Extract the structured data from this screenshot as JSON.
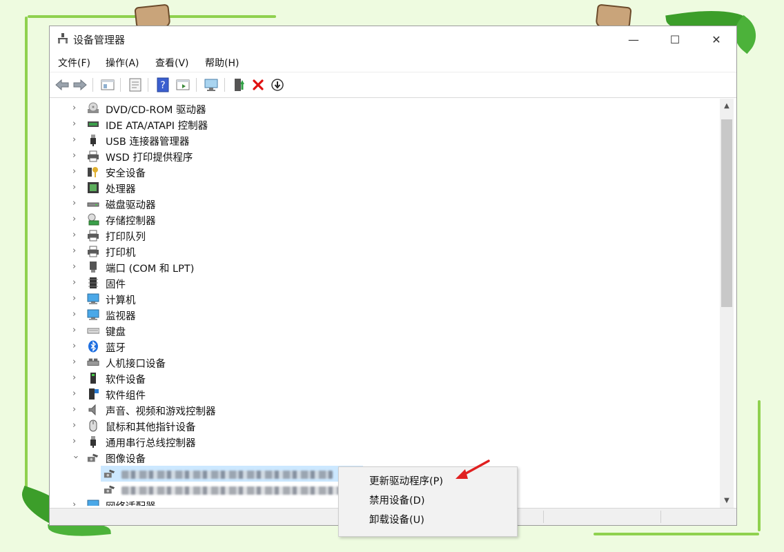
{
  "window": {
    "title": "设备管理器",
    "controls": {
      "minimize": "—",
      "maximize": "☐",
      "close": "✕"
    }
  },
  "menu": [
    "文件(F)",
    "操作(A)",
    "查看(V)",
    "帮助(H)"
  ],
  "toolbar": [
    "back-icon",
    "forward-icon",
    "view-icon",
    "properties-icon",
    "help-icon",
    "show-hidden-icon",
    "scan-hardware-icon",
    "update-driver-icon",
    "uninstall-icon",
    "disable-icon"
  ],
  "tree": {
    "categories": [
      {
        "label": "DVD/CD-ROM 驱动器",
        "icon": "dvd-drive-icon"
      },
      {
        "label": "IDE ATA/ATAPI 控制器",
        "icon": "ide-controller-icon"
      },
      {
        "label": "USB 连接器管理器",
        "icon": "usb-icon"
      },
      {
        "label": "WSD 打印提供程序",
        "icon": "printer-icon"
      },
      {
        "label": "安全设备",
        "icon": "security-key-icon"
      },
      {
        "label": "处理器",
        "icon": "processor-icon"
      },
      {
        "label": "磁盘驱动器",
        "icon": "disk-drive-icon"
      },
      {
        "label": "存储控制器",
        "icon": "storage-controller-icon"
      },
      {
        "label": "打印队列",
        "icon": "print-queue-icon"
      },
      {
        "label": "打印机",
        "icon": "printer-icon"
      },
      {
        "label": "端口 (COM 和 LPT)",
        "icon": "port-icon"
      },
      {
        "label": "固件",
        "icon": "firmware-icon"
      },
      {
        "label": "计算机",
        "icon": "computer-icon"
      },
      {
        "label": "监视器",
        "icon": "monitor-icon"
      },
      {
        "label": "键盘",
        "icon": "keyboard-icon"
      },
      {
        "label": "蓝牙",
        "icon": "bluetooth-icon"
      },
      {
        "label": "人机接口设备",
        "icon": "hid-icon"
      },
      {
        "label": "软件设备",
        "icon": "software-device-icon"
      },
      {
        "label": "软件组件",
        "icon": "software-component-icon"
      },
      {
        "label": "声音、视频和游戏控制器",
        "icon": "sound-icon"
      },
      {
        "label": "鼠标和其他指针设备",
        "icon": "mouse-icon"
      },
      {
        "label": "通用串行总线控制器",
        "icon": "usb-controller-icon"
      },
      {
        "label": "图像设备",
        "icon": "camera-icon",
        "expanded": true
      },
      {
        "label": "网络适配器",
        "icon": "network-adapter-icon"
      }
    ]
  },
  "context_menu": {
    "items": [
      "更新驱动程序(P)",
      "禁用设备(D)",
      "卸载设备(U)"
    ]
  },
  "colors": {
    "selection": "#cce8ff",
    "accent_arrow": "#e02020"
  }
}
